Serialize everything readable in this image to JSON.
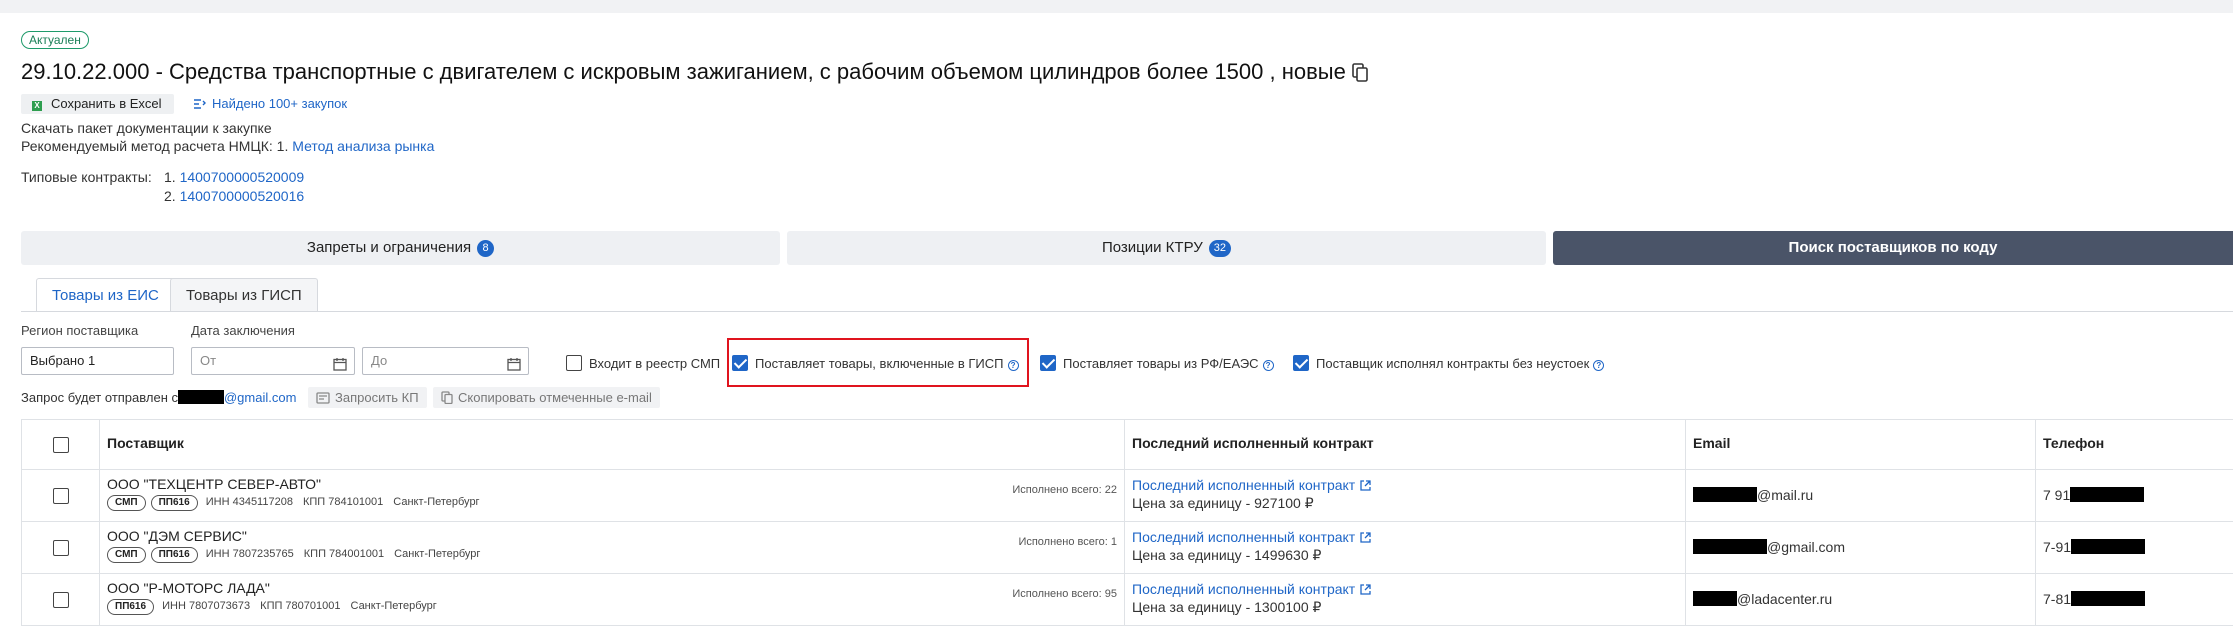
{
  "status_badge": "Актуален",
  "title": "29.10.22.000 - Средства транспортные с двигателем с искровым зажиганием, с рабочим объемом цилиндров более 1500  , новые",
  "actions": {
    "excel_label": "Сохранить в Excel",
    "found_label": "Найдено 100+ закупок"
  },
  "download_link": "Скачать пакет документации к закупке",
  "method": {
    "prefix": "Рекомендуемый метод расчета НМЦК: 1.",
    "link": "Метод анализа рынка"
  },
  "contracts": {
    "label": "Типовые контракты:",
    "items": [
      {
        "num": "1.",
        "id": "1400700000520009"
      },
      {
        "num": "2.",
        "id": "1400700000520016"
      }
    ]
  },
  "top_tabs": [
    {
      "label": "Запреты и ограничения",
      "count": "8"
    },
    {
      "label": "Позиции КТРУ",
      "count": "32"
    },
    {
      "label": "Поиск поставщиков по коду"
    }
  ],
  "sub_tabs": [
    "Товары из ЕИС",
    "Товары из ГИСП"
  ],
  "filters": {
    "region_label": "Регион поставщика",
    "region_value": "Выбрано 1",
    "date_label": "Дата заключения",
    "date_from_placeholder": "От",
    "date_to_placeholder": "До",
    "checkboxes": [
      {
        "label": "Входит в реестр СМП",
        "checked": false
      },
      {
        "label": "Поставляет товары, включенные в ГИСП",
        "checked": true
      },
      {
        "label": "Поставляет товары из РФ/ЕАЭС",
        "checked": true
      },
      {
        "label": "Поставщик исполнял контракты без неустоек",
        "checked": true
      }
    ]
  },
  "request": {
    "prefix": "Запрос будет отправлен с",
    "email_suffix": "@gmail.com",
    "request_kp": "Запросить КП",
    "copy_emails": "Скопировать отмеченные e-mail"
  },
  "table": {
    "columns": [
      "Поставщик",
      "Последний исполненный контракт",
      "Email",
      "Телефон"
    ],
    "rows": [
      {
        "name": "ООО \"ТЕХЦЕНТР СЕВЕР-АВТО\"",
        "tags": [
          "СМП",
          "ПП616"
        ],
        "inn": "ИНН 4345117208",
        "kpp": "КПП 784101001",
        "city": "Санкт-Петербург",
        "done": "Исполнено всего: 22",
        "contract": "Последний исполненный контракт",
        "price": "Цена за единицу - 927100 ₽",
        "email_suffix": "@mail.ru",
        "phone_prefix": "7 91"
      },
      {
        "name": "ООО \"ДЭМ СЕРВИС\"",
        "tags": [
          "СМП",
          "ПП616"
        ],
        "inn": "ИНН 7807235765",
        "kpp": "КПП 784001001",
        "city": "Санкт-Петербург",
        "done": "Исполнено всего: 1",
        "contract": "Последний исполненный контракт",
        "price": "Цена за единицу - 1499630 ₽",
        "email_suffix": "@gmail.com",
        "phone_prefix": "7-91"
      },
      {
        "name": "ООО \"Р-МОТОРС ЛАДА\"",
        "tags": [
          "ПП616"
        ],
        "inn": "ИНН 7807073673",
        "kpp": "КПП 780701001",
        "city": "Санкт-Петербург",
        "done": "Исполнено всего: 95",
        "contract": "Последний исполненный контракт",
        "price": "Цена за единицу - 1300100 ₽",
        "email_suffix": "@ladacenter.ru",
        "phone_prefix": "7-81"
      }
    ]
  },
  "colors": {
    "accent": "#1f66c7",
    "dark_tab": "#4a5468",
    "highlight": "#e0141e",
    "status": "#1e9a6a"
  }
}
